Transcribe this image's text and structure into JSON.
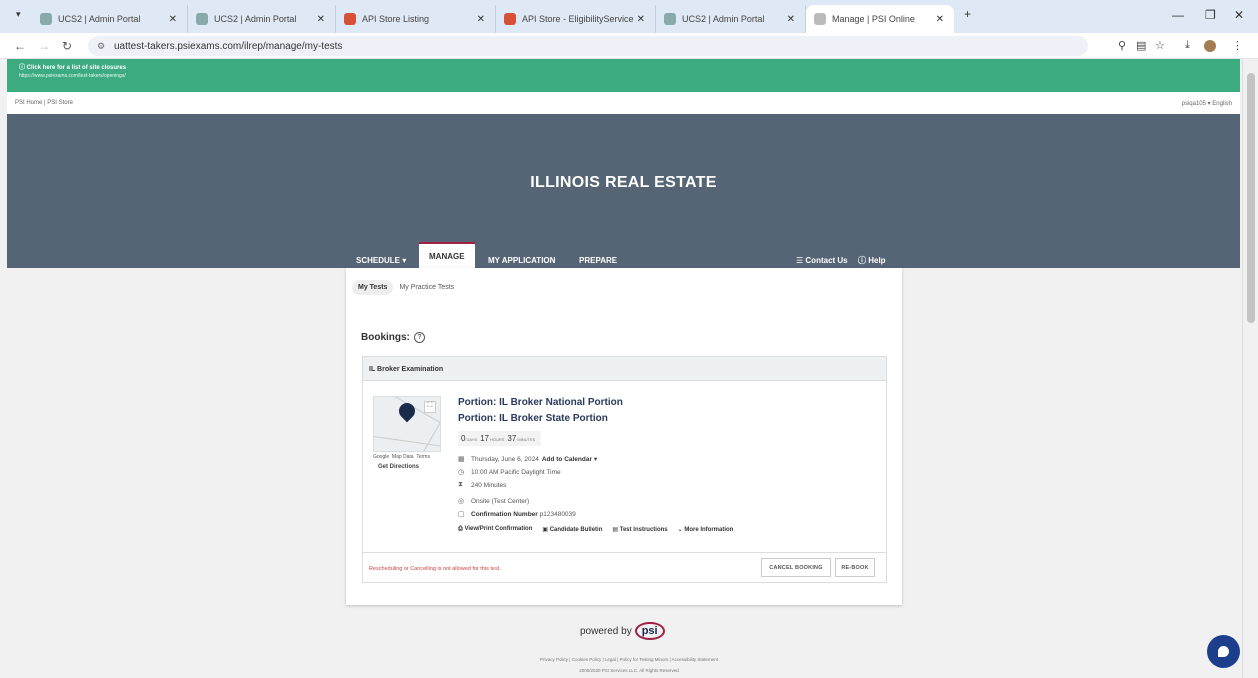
{
  "browser": {
    "tabs": [
      {
        "label": "UCS2 | Admin Portal",
        "active": false
      },
      {
        "label": "UCS2 | Admin Portal",
        "active": false
      },
      {
        "label": "API Store Listing",
        "active": false
      },
      {
        "label": "API Store - EligibilityService",
        "active": false
      },
      {
        "label": "UCS2 | Admin Portal",
        "active": false
      },
      {
        "label": "Manage | PSI Online",
        "active": true
      }
    ],
    "url": "uattest-takers.psiexams.com/ilrep/manage/my-tests"
  },
  "banner": {
    "title": "Click here for a list of site closures",
    "link": "https://www.psiexams.com/test-takers/openings/"
  },
  "utility": {
    "left": "PSI Home  |  PSI Store",
    "right": "psiqa105 ▾   English"
  },
  "hero": {
    "title": "ILLINOIS REAL ESTATE"
  },
  "menu": {
    "schedule": "SCHEDULE ▾",
    "manage": "MANAGE",
    "application": "MY APPLICATION",
    "prepare": "PREPARE",
    "contact": "Contact Us",
    "help": "Help"
  },
  "subtabs": {
    "my_tests": "My Tests",
    "practice": "My Practice Tests"
  },
  "bookings": {
    "label": "Bookings:",
    "exam_name": "IL Broker Examination",
    "portion1": "Portion: IL Broker National Portion",
    "portion2": "Portion: IL Broker State Portion",
    "countdown": {
      "days": "0",
      "days_label": "DAYS",
      "hours": "17",
      "hours_label": "HOURS",
      "minutes": "37",
      "minutes_label": "MINUTES"
    },
    "date": "Thursday, June 6, 2024",
    "add_calendar": "Add to Calendar ▾",
    "time": "10:00 AM Pacific Daylight Time",
    "duration": "240 Minutes",
    "location": "Onsite (Test Center)",
    "confirmation_label": "Confirmation Number",
    "confirmation_value": "p123480039",
    "get_directions": "Get Directions",
    "links": {
      "view_print": "View/Print Confirmation",
      "bulletin": "Candidate Bulletin",
      "instructions": "Test Instructions",
      "more": "More Information"
    },
    "warning": "Rescheduling or Cancelling is not allowed for this test.",
    "cancel_btn": "CANCEL BOOKING",
    "rebook_btn": "RE-BOOK"
  },
  "footer": {
    "powered": "powered by",
    "brand": "psi",
    "links": "Privacy Policy  |  Cookies Policy  |  Legal  |  Policy for Testing Minors  |  Accessibility Statement",
    "copyright": "2000/2020 PSI Services LLC. All Rights Reserved"
  }
}
